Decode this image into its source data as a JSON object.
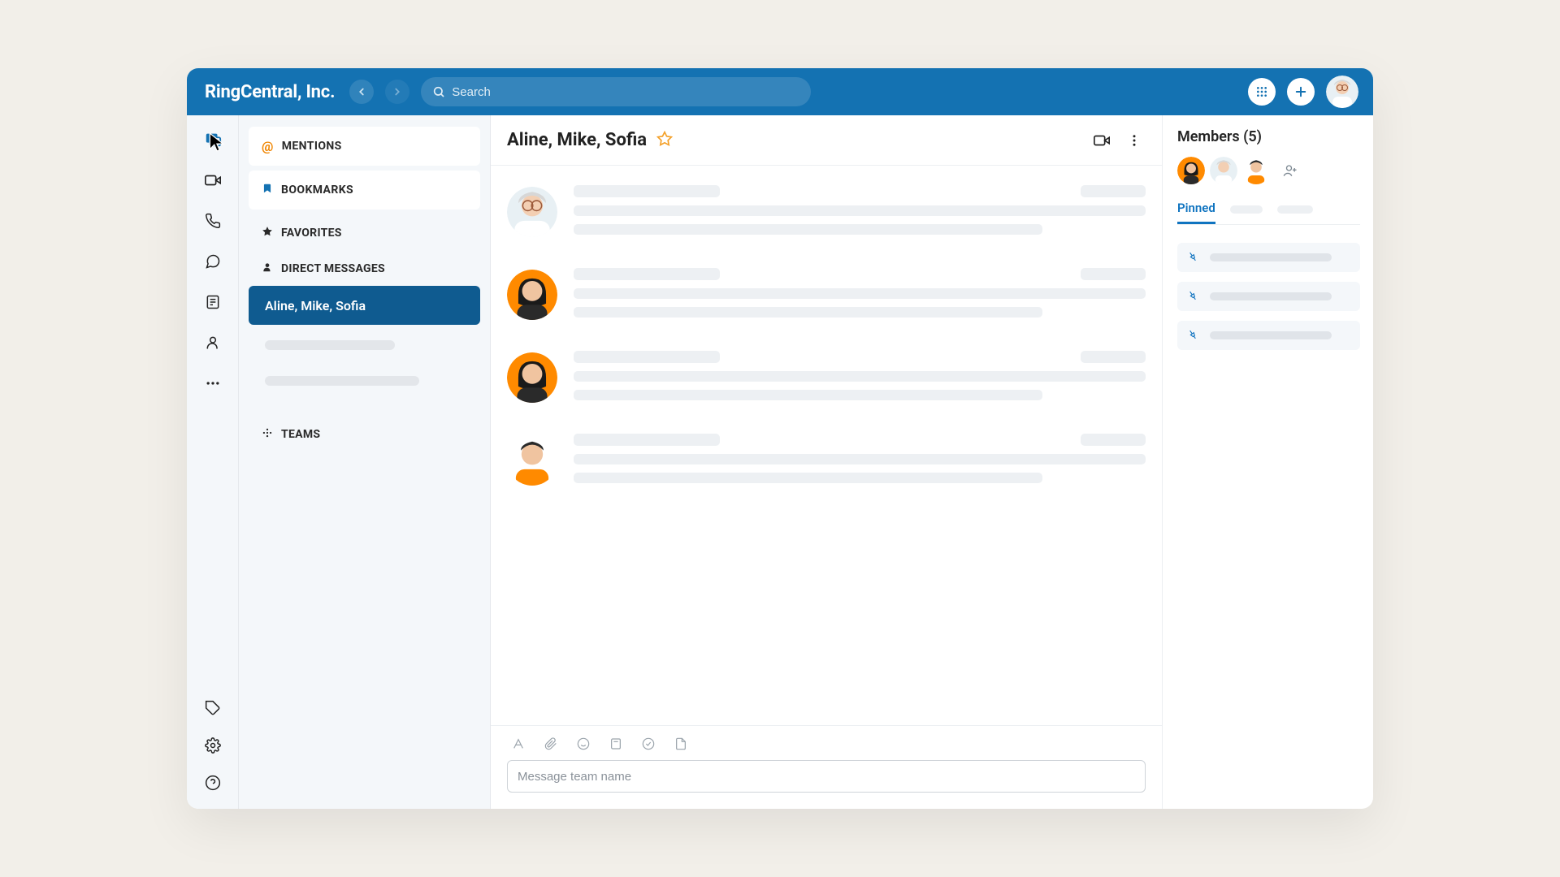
{
  "header": {
    "brand": "RingCentral, Inc.",
    "search_placeholder": "Search"
  },
  "rail": {
    "items": [
      "message",
      "video",
      "phone",
      "text",
      "tasks",
      "contacts",
      "more"
    ],
    "bottom": [
      "apps",
      "settings",
      "help"
    ]
  },
  "sidebar": {
    "mentions_label": "MENTIONS",
    "bookmarks_label": "BOOKMARKS",
    "favorites_label": "FAVORITES",
    "direct_messages_label": "DIRECT MESSAGES",
    "dm_items": [
      {
        "label": "Aline, Mike, Sofia",
        "selected": true
      }
    ],
    "teams_label": "TEAMS"
  },
  "chat": {
    "title": "Aline, Mike, Sofia",
    "compose_placeholder": "Message team name"
  },
  "panel": {
    "members_title": "Members (5)",
    "pinned_tab": "Pinned"
  },
  "colors": {
    "primary": "#1472b2",
    "accent_orange": "#f08500"
  },
  "avatars": {
    "grey_hair": {
      "bg": "#e8f0f4",
      "hair": "#d7d7d7",
      "skin": "#f3cfb3",
      "shirt": "#ffffff"
    },
    "black_hair_orange": {
      "bg": "#ff8a00",
      "hair": "#1a1a1a",
      "skin": "#f0c4a0",
      "shirt": "#2a2a2a"
    },
    "short_hair_orange": {
      "bg": "#ffffff",
      "hair": "#2a2a2a",
      "skin": "#f0c4a0",
      "shirt": "#ff8a00"
    }
  }
}
